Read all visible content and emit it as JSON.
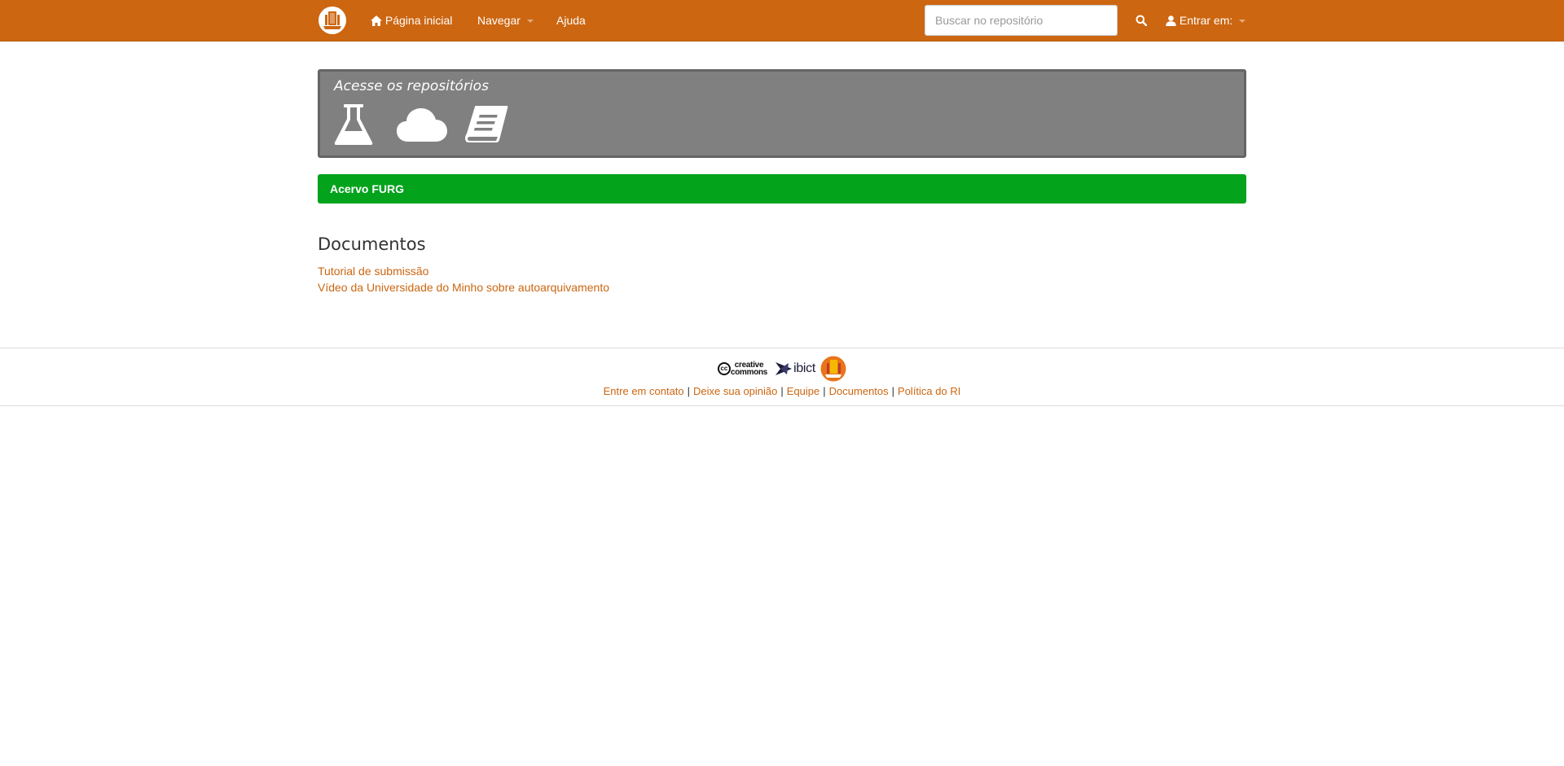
{
  "navbar": {
    "logo_icon": "repository-logo-icon",
    "home_label": "Página inicial",
    "browse_label": "Navegar",
    "help_label": "Ajuda",
    "search_placeholder": "Buscar no repositório",
    "search_value": "",
    "login_label": "Entrar em:",
    "background_color": "#cc6611"
  },
  "repositories": {
    "title": "Acesse os repositórios",
    "icons": [
      "flask-icon",
      "cloud-icon",
      "book-icon"
    ],
    "background_color": "#808080"
  },
  "acervo": {
    "label": "Acervo FURG",
    "background_color": "#03a31c"
  },
  "documents": {
    "heading": "Documentos",
    "links": [
      "Tutorial de submissão",
      "Vídeo da Universidade do Minho sobre autoarquivamento"
    ]
  },
  "footer": {
    "logos": {
      "cc_badge": "cc",
      "cc_line1": "creative",
      "cc_line2": "commons",
      "ibict": "ibict"
    },
    "links": [
      "Entre em contato",
      "Deixe sua opinião",
      "Equipe",
      "Documentos",
      "Política do RI"
    ],
    "separator": "|"
  }
}
